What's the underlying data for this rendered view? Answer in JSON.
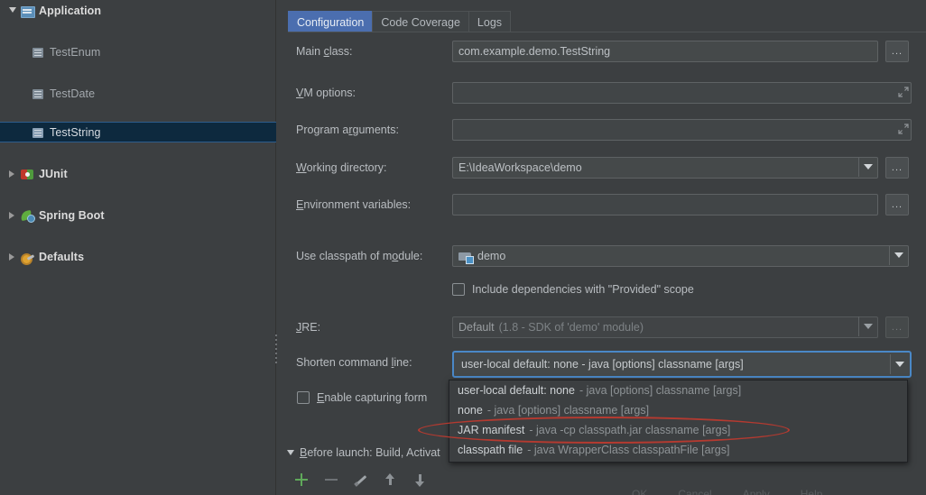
{
  "sidebar": {
    "items": [
      {
        "label": "Application",
        "icon": "application-icon",
        "twisty": "expanded",
        "level": 0,
        "selected": false
      },
      {
        "label": "TestEnum",
        "icon": "java-class-icon",
        "twisty": "none",
        "level": 1,
        "selected": false
      },
      {
        "label": "TestDate",
        "icon": "java-class-icon",
        "twisty": "none",
        "level": 1,
        "selected": false
      },
      {
        "label": "TestString",
        "icon": "java-class-icon",
        "twisty": "none",
        "level": 1,
        "selected": true
      },
      {
        "label": "JUnit",
        "icon": "junit-icon",
        "twisty": "collapsed",
        "level": 0,
        "selected": false
      },
      {
        "label": "Spring Boot",
        "icon": "spring-boot-icon",
        "twisty": "collapsed",
        "level": 0,
        "selected": false
      },
      {
        "label": "Defaults",
        "icon": "defaults-gear-icon",
        "twisty": "collapsed",
        "level": 0,
        "selected": false
      }
    ]
  },
  "tabs": [
    {
      "label": "Configuration",
      "active": true
    },
    {
      "label": "Code Coverage",
      "active": false
    },
    {
      "label": "Logs",
      "active": false
    }
  ],
  "form": {
    "main_class": {
      "label": "Main class:",
      "value": "com.example.demo.TestString",
      "browse": "..."
    },
    "vm_options": {
      "label": "VM options:",
      "value": "",
      "expand_icon": "expand-editor-icon"
    },
    "program_arguments": {
      "label": "Program arguments:",
      "value": "",
      "expand_icon": "expand-editor-icon"
    },
    "working_directory": {
      "label": "Working directory:",
      "value": "E:\\IdeaWorkspace\\demo",
      "browse": "..."
    },
    "environment_variables": {
      "label": "Environment variables:",
      "value": "",
      "browse": "..."
    },
    "use_classpath_of_module": {
      "label": "Use classpath of module:",
      "value": "demo",
      "icon": "module-icon"
    },
    "include_provided": {
      "label": "Include dependencies with \"Provided\" scope",
      "checked": false
    },
    "jre": {
      "label": "JRE:",
      "value": "Default",
      "hint": "(1.8 - SDK of 'demo' module)",
      "browse": "..."
    },
    "shorten_command_line": {
      "label": "Shorten command line:",
      "value": "user-local default: none - java [options] classname [args]"
    },
    "enable_capturing": {
      "label": "Enable capturing form",
      "checked": false
    }
  },
  "dropdown": {
    "open": true,
    "options": [
      {
        "name": "user-local default: none",
        "desc": "- java [options] classname [args]",
        "highlighted": false
      },
      {
        "name": "none",
        "desc": "- java [options] classname [args]",
        "highlighted": false
      },
      {
        "name": "JAR manifest",
        "desc": "- java -cp classpath.jar classname [args]",
        "highlighted": false
      },
      {
        "name": "classpath file",
        "desc": "- java WrapperClass classpathFile [args]",
        "highlighted": false
      }
    ],
    "annotated_option_index": 2
  },
  "before_launch": {
    "label": "Before launch: Build, Activat",
    "toolbar": [
      {
        "name": "add-icon",
        "glyph": "+"
      },
      {
        "name": "remove-icon",
        "glyph": "-"
      },
      {
        "name": "edit-icon",
        "glyph": "pencil"
      },
      {
        "name": "move-up-icon",
        "glyph": "up"
      },
      {
        "name": "move-down-icon",
        "glyph": "down"
      }
    ]
  },
  "colors": {
    "background": "#3c3f41",
    "selection": "#0d293e",
    "tab_active": "#4b6eaf",
    "focus_border": "#4a88c7",
    "annotation": "#c0392f",
    "add_icon": "#5fa85a"
  }
}
